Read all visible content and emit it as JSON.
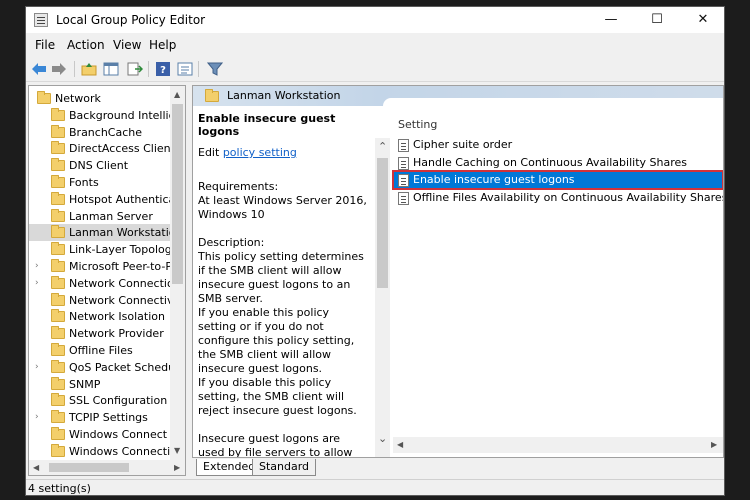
{
  "window": {
    "title": "Local Group Policy Editor",
    "minimize": "—",
    "maximize": "☐",
    "close": "✕"
  },
  "menu": [
    "File",
    "Action",
    "View",
    "Help"
  ],
  "toolbar": {
    "icons": [
      "back-arrow-icon",
      "forward-arrow-icon",
      "up-folder-icon",
      "show-hide-tree-icon",
      "export-list-icon",
      "help-icon",
      "properties-icon",
      "filter-icon"
    ]
  },
  "tree": {
    "items": [
      {
        "label": "Network",
        "expander": "",
        "selected": false
      },
      {
        "label": "Background Intelliger",
        "expander": "",
        "selected": false
      },
      {
        "label": "BranchCache",
        "expander": "",
        "selected": false
      },
      {
        "label": "DirectAccess Client Exp",
        "expander": "",
        "selected": false
      },
      {
        "label": "DNS Client",
        "expander": "",
        "selected": false
      },
      {
        "label": "Fonts",
        "expander": "",
        "selected": false
      },
      {
        "label": "Hotspot Authenticatio",
        "expander": "",
        "selected": false
      },
      {
        "label": "Lanman Server",
        "expander": "",
        "selected": false
      },
      {
        "label": "Lanman Workstation",
        "expander": "",
        "selected": true
      },
      {
        "label": "Link-Layer Topology D",
        "expander": "",
        "selected": false
      },
      {
        "label": "Microsoft Peer-to-Pee",
        "expander": "›",
        "selected": false
      },
      {
        "label": "Network Connections",
        "expander": "›",
        "selected": false
      },
      {
        "label": "Network Connectivity",
        "expander": "",
        "selected": false
      },
      {
        "label": "Network Isolation",
        "expander": "",
        "selected": false
      },
      {
        "label": "Network Provider",
        "expander": "",
        "selected": false
      },
      {
        "label": "Offline Files",
        "expander": "",
        "selected": false
      },
      {
        "label": "QoS Packet Scheduler",
        "expander": "›",
        "selected": false
      },
      {
        "label": "SNMP",
        "expander": "",
        "selected": false
      },
      {
        "label": "SSL Configuration Set",
        "expander": "",
        "selected": false
      },
      {
        "label": "TCPIP Settings",
        "expander": "›",
        "selected": false
      },
      {
        "label": "Windows Connect No",
        "expander": "",
        "selected": false
      },
      {
        "label": "Windows Connection",
        "expander": "",
        "selected": false
      }
    ]
  },
  "right": {
    "header_title": "Lanman Workstation",
    "policy_title": "Enable insecure guest logons",
    "edit_prefix": "Edit ",
    "edit_link": "policy setting",
    "requirements_label": "Requirements:",
    "requirements_text": "At least Windows Server 2016, Windows 10",
    "description_label": "Description:",
    "description_p1": "This policy setting determines if the SMB client will allow insecure guest logons to an SMB server.",
    "description_p2": "If you enable this policy setting or if you do not configure this policy setting, the SMB client will allow insecure guest logons.",
    "description_p3": "If you disable this policy setting, the SMB client will reject insecure guest logons.",
    "description_p4": "Insecure guest logons are used by file servers to allow unauthenticated access to shared"
  },
  "settings": {
    "column_header": "Setting",
    "rows": [
      {
        "label": "Cipher suite order",
        "selected": false
      },
      {
        "label": "Handle Caching on Continuous Availability Shares",
        "selected": false
      },
      {
        "label": "Enable insecure guest logons",
        "selected": true
      },
      {
        "label": "Offline Files Availability on Continuous Availability Shares",
        "selected": false
      }
    ]
  },
  "tabs": [
    {
      "label": "Extended",
      "active": true
    },
    {
      "label": "Standard",
      "active": false
    }
  ],
  "status": {
    "text": "4 setting(s)"
  },
  "colors": {
    "selection": "#0078d7",
    "highlight_outline": "#d1323a",
    "folder": "#f3cf6b",
    "link": "#1060c8"
  }
}
